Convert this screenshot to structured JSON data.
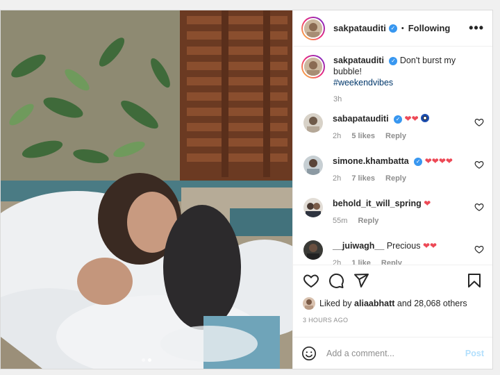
{
  "header": {
    "username": "sakpatauditi",
    "follow_status": "Following",
    "more": "•••"
  },
  "caption": {
    "username": "sakpatauditi",
    "text": "Don't burst my bubble!",
    "hashtag": "#weekendvibes",
    "time": "3h"
  },
  "comments": [
    {
      "username": "sabapatauditi",
      "text": "",
      "time": "2h",
      "likes": "5 likes",
      "reply": "Reply"
    },
    {
      "username": "simone.khambatta",
      "text": "",
      "time": "2h",
      "likes": "7 likes",
      "reply": "Reply"
    },
    {
      "username": "behold_it_will_spring",
      "text": "",
      "time": "55m",
      "likes": "",
      "reply": "Reply"
    },
    {
      "username": "__juiwagh__",
      "text": "Precious",
      "time": "2h",
      "likes": "1 like",
      "reply": "Reply"
    }
  ],
  "likes": {
    "prefix": "Liked by",
    "user": "aliaabhatt",
    "suffix": "and 28,068 others"
  },
  "posted_ago": "3 HOURS AGO",
  "add_comment": {
    "placeholder": "Add a comment...",
    "post_label": "Post"
  },
  "colors": {
    "accent_blue": "#3897f0",
    "heart_red": "#ed4956",
    "post_disabled": "#b2dffc"
  }
}
